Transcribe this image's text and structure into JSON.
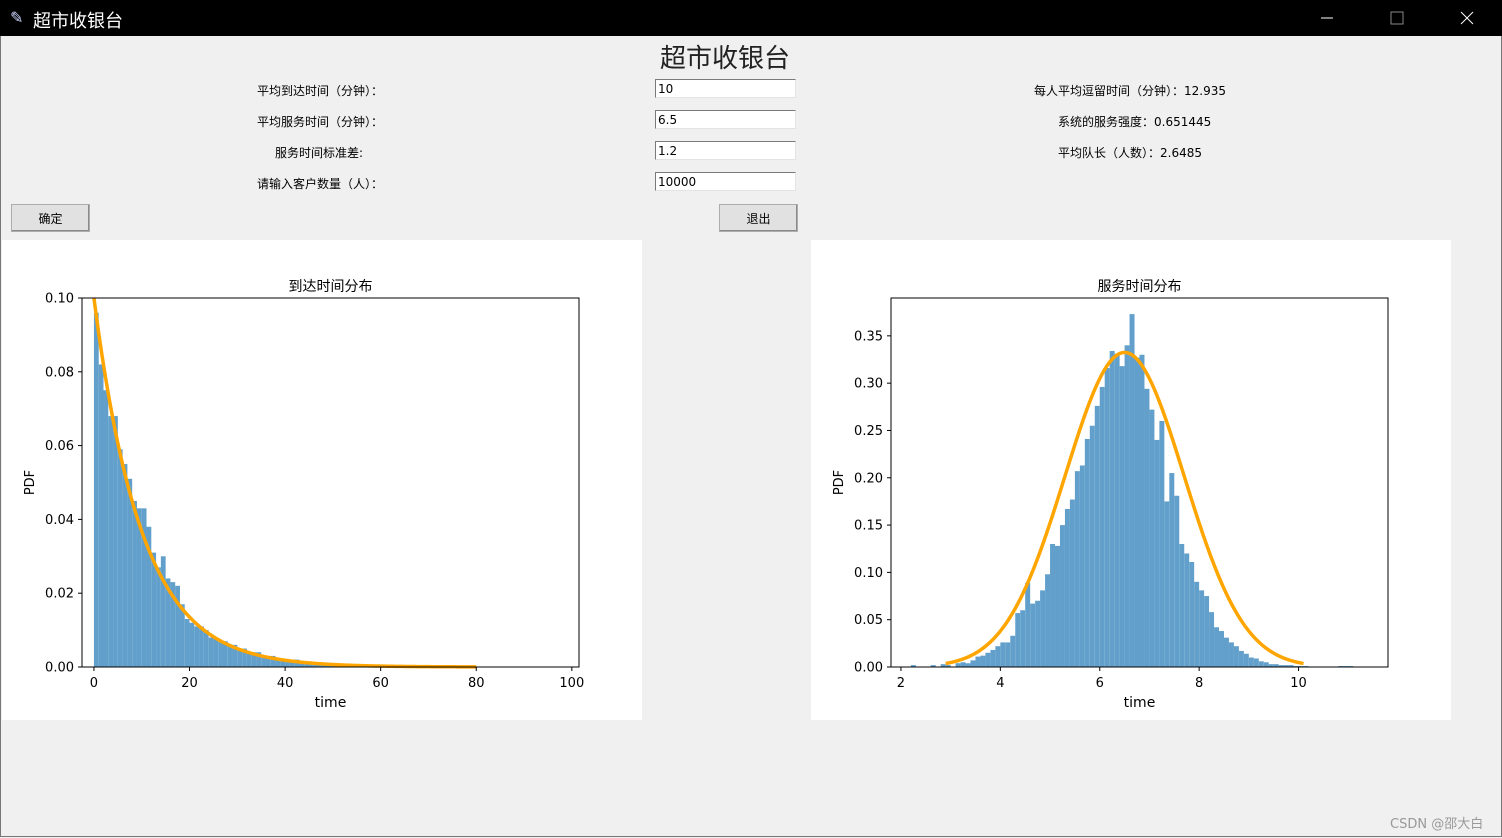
{
  "window": {
    "title": "超市收银台",
    "minimize": "—",
    "maximize": "☐",
    "close": "✕"
  },
  "heading": "超市收银台",
  "form": {
    "arrival_label": "平均到达时间（分钟）：",
    "arrival_value": "10",
    "service_label": "平均服务时间（分钟）：",
    "service_value": "6.5",
    "std_label": "服务时间标准差:",
    "std_value": "1.2",
    "count_label": "请输入客户数量（人）：",
    "count_value": "10000"
  },
  "results": {
    "avg_stay": "每人平均逗留时间（分钟）：12.935",
    "intensity": "系统的服务强度：0.651445",
    "queue_len": "平均队长（人数）：2.6485"
  },
  "buttons": {
    "confirm": "确定",
    "exit": "退出"
  },
  "watermark": "CSDN @邵大白",
  "colors": {
    "bar": "#62a0cb",
    "curve": "#ffa500"
  },
  "chart_data": [
    {
      "type": "histogram",
      "title": "到达时间分布",
      "xlabel": "time",
      "ylabel": "PDF",
      "xlim": [
        -2.5,
        101.5
      ],
      "ylim": [
        0,
        0.1
      ],
      "xticks": [
        "0",
        "20",
        "40",
        "60",
        "80",
        "100"
      ],
      "xtick_values": [
        0,
        20,
        40,
        60,
        80,
        100
      ],
      "yticks": [
        "0.00",
        "0.02",
        "0.04",
        "0.06",
        "0.08",
        "0.10"
      ],
      "ytick_values": [
        0,
        0.02,
        0.04,
        0.06,
        0.08,
        0.1
      ],
      "bin_start": 0,
      "bin_width": 1,
      "bar_values": [
        0.096,
        0.082,
        0.075,
        0.068,
        0.068,
        0.059,
        0.055,
        0.051,
        0.045,
        0.043,
        0.043,
        0.038,
        0.031,
        0.027,
        0.03,
        0.024,
        0.023,
        0.022,
        0.017,
        0.013,
        0.012,
        0.011,
        0.011,
        0.01,
        0.008,
        0.008,
        0.007,
        0.007,
        0.006,
        0.006,
        0.005,
        0.005,
        0.004,
        0.004,
        0.004,
        0.003,
        0.003,
        0.003,
        0.002,
        0.002,
        0.002,
        0.002,
        0.002,
        0.001,
        0.001,
        0.001,
        0.001,
        0.001,
        0.001,
        0.001,
        0.001,
        0.0005,
        0.0005,
        0.0005,
        0.0005,
        0.0005,
        0.0005,
        0.0004,
        0.0004,
        0.0003,
        0.0003,
        0.0003,
        0.0002,
        0.0002,
        0.0002,
        0.0002,
        0.0001,
        0.0001,
        0.0001,
        0.0001,
        0.0001,
        0.0001,
        0.0001,
        0.0001,
        0.0001,
        0.0001,
        0.0001,
        0.0001,
        0.0001,
        0.0001
      ],
      "curve": {
        "kind": "exponential",
        "scale": 10,
        "x_range": [
          0,
          80
        ]
      }
    },
    {
      "type": "histogram",
      "title": "服务时间分布",
      "xlabel": "time",
      "ylabel": "PDF",
      "xlim": [
        1.8,
        11.8
      ],
      "ylim": [
        0,
        0.39
      ],
      "xticks": [
        "2",
        "4",
        "6",
        "8",
        "10"
      ],
      "xtick_values": [
        2,
        4,
        6,
        8,
        10
      ],
      "yticks": [
        "0.00",
        "0.05",
        "0.10",
        "0.15",
        "0.20",
        "0.25",
        "0.30",
        "0.35"
      ],
      "ytick_values": [
        0,
        0.05,
        0.1,
        0.15,
        0.2,
        0.25,
        0.3,
        0.35
      ],
      "bin_start": 2.2,
      "bin_width": 0.1,
      "bar_values": [
        0.002,
        0,
        0,
        0,
        0.002,
        0,
        0.003,
        0.002,
        0,
        0.004,
        0.005,
        0.004,
        0.007,
        0.011,
        0.012,
        0.015,
        0.018,
        0.022,
        0.026,
        0.026,
        0.033,
        0.057,
        0.06,
        0.089,
        0.067,
        0.07,
        0.081,
        0.098,
        0.13,
        0.128,
        0.15,
        0.167,
        0.177,
        0.207,
        0.213,
        0.241,
        0.255,
        0.276,
        0.296,
        0.316,
        0.334,
        0.331,
        0.318,
        0.34,
        0.373,
        0.327,
        0.33,
        0.294,
        0.272,
        0.24,
        0.26,
        0.175,
        0.205,
        0.181,
        0.13,
        0.12,
        0.111,
        0.09,
        0.081,
        0.075,
        0.058,
        0.042,
        0.038,
        0.031,
        0.026,
        0.022,
        0.017,
        0.014,
        0.01,
        0.009,
        0.006,
        0.005,
        0.003,
        0.003,
        0.002,
        0.002,
        0.002,
        0.001,
        0.001,
        0.001,
        0,
        0,
        0,
        0,
        0,
        0,
        0.001,
        0.001,
        0.001
      ],
      "curve": {
        "kind": "normal",
        "mean": 6.5,
        "std": 1.2,
        "x_range": [
          2.9,
          10.1
        ]
      }
    }
  ]
}
